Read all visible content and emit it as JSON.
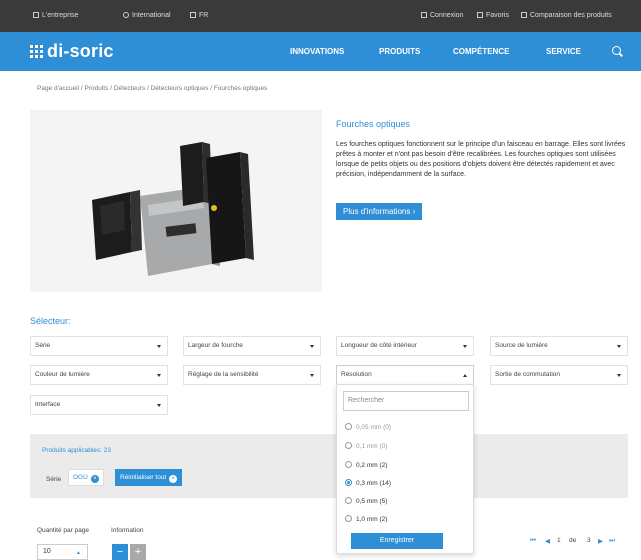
{
  "topbar": {
    "company": "L'entreprise",
    "international": "International",
    "language": "FR",
    "login": "Connexion",
    "favorites": "Favoris",
    "compare": "Comparaison des produits"
  },
  "navbar": {
    "logo": "di-soric",
    "links": [
      "INNOVATIONS",
      "PRODUITS",
      "COMPÉTENCE",
      "SERVICE"
    ]
  },
  "breadcrumb": "Page d'accueil / Produits / Détecteurs / Détecteurs optiques / Fourches optiques",
  "intro": {
    "title": "Fourches optiques",
    "text": "Les fourches optiques fonctionnent sur le principe d'un faisceau en barrage. Elles sont livrées prêtes à monter et n'ont pas besoin d'être recalibrées. Les fourches optiques sont utilisées lorsque de petits objets ou des positions d'objets doivent être détectés rapidement et avec précision, indépendamment de la surface.",
    "button": "Plus d'informations"
  },
  "selector": {
    "title": "Sélecteur:",
    "filters": {
      "serie": "Série",
      "largeur": "Largeur de fourche",
      "longueur": "Longueur de côté intérieur",
      "source": "Source de lumière",
      "couleur": "Couleur de lumière",
      "reglage": "Réglage de la sensibilité",
      "resolution": "Résolution",
      "sortie": "Sortie de commutation",
      "interface": "Interface"
    },
    "dropdown": {
      "placeholder": "Rechercher",
      "options": [
        {
          "label": "0,05 mm (0)",
          "checked": false
        },
        {
          "label": "0,1 mm (0)",
          "checked": false
        },
        {
          "label": "0,2 mm (2)",
          "checked": false
        },
        {
          "label": "0,3 mm (14)",
          "checked": true
        },
        {
          "label": "0,5 mm (5)",
          "checked": false
        },
        {
          "label": "1,0 mm (2)",
          "checked": false
        }
      ],
      "save": "Enregistrer"
    }
  },
  "results": {
    "count": "Produits applicables: 23",
    "chip_label": "Série",
    "chip_value": "OGU",
    "reset": "Réinitialiser tout",
    "clear_icon": "×"
  },
  "footer": {
    "per_page_label": "Quantité par page",
    "info_label": "Information",
    "per_page_value": "10",
    "minus": "−",
    "plus": "+",
    "pager": {
      "first": "⏮",
      "prev": "◀",
      "page": "1",
      "of": "de",
      "total": "3",
      "next": "▶",
      "last": "⏭"
    }
  },
  "colors": {
    "accent": "#2e8fd6",
    "topbar": "#3a3a3a"
  }
}
